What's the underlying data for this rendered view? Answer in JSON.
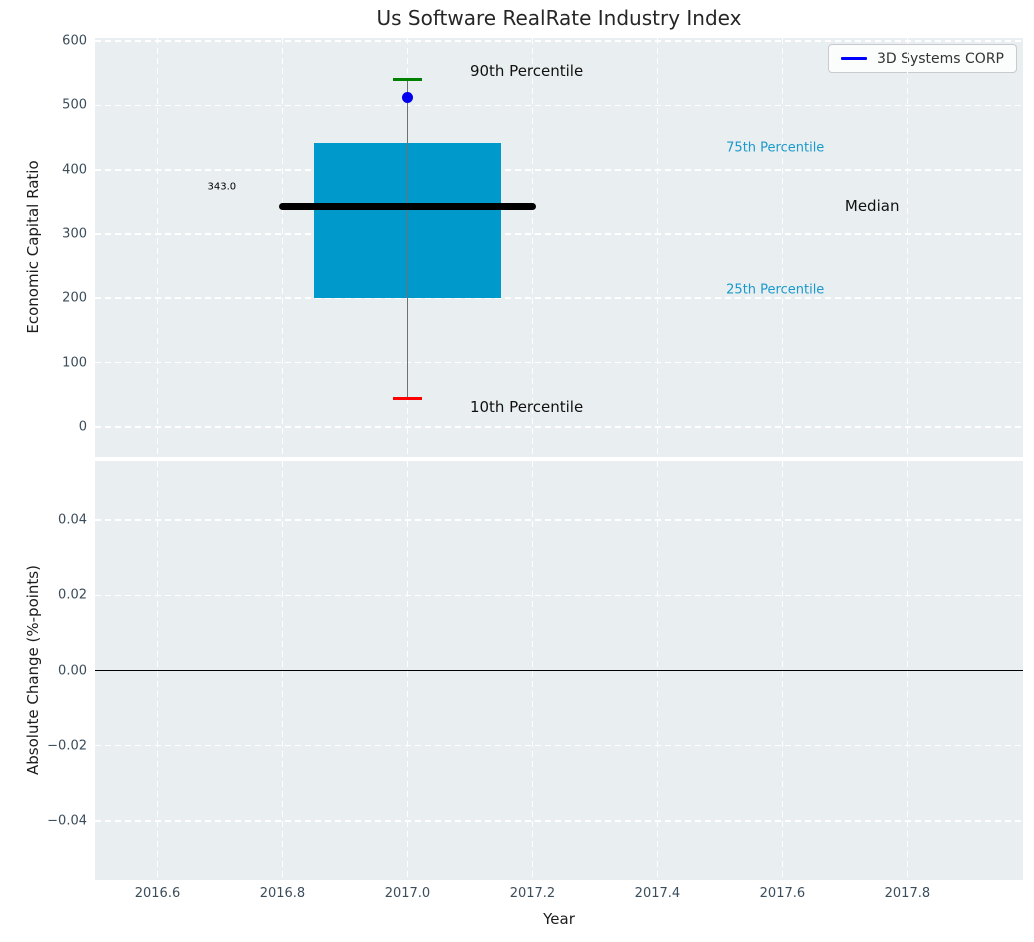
{
  "title": "Us Software RealRate Industry Index",
  "colors": {
    "axes_background": "#e9eef0",
    "grid": "#ffffff",
    "tick_label": "#3b4c5a",
    "box_fill": "#0099cc",
    "median_line": "#000000",
    "whisker": "#707070",
    "cap_90th": "#008000",
    "cap_10th": "#ff0000",
    "company_point": "#0000ee",
    "legend_line": "#0000ff",
    "zero_line": "#000000",
    "percentile_text_cyan": "#1a99cc"
  },
  "chart_data": [
    {
      "type": "boxplot",
      "panel": "top",
      "ylabel": "Economic Capital Ratio",
      "ylim": [
        -47,
        605
      ],
      "yticks": [
        0,
        100,
        200,
        300,
        400,
        500,
        600
      ],
      "ytick_labels": [
        "0",
        "100",
        "200",
        "300",
        "400",
        "500",
        "600"
      ],
      "xlim": [
        2016.5,
        2017.985
      ],
      "xgrid_ticks": [
        2016.6,
        2016.8,
        2017.0,
        2017.2,
        2017.4,
        2017.6,
        2017.8
      ],
      "grid": "white-dashed",
      "legend": {
        "label": "3D Systems CORP",
        "position": "upper right",
        "line_color": "#0000ff"
      },
      "box": {
        "x": 2017.0,
        "p10": 44,
        "p25": 200,
        "median": 343.0,
        "p75": 442,
        "p90": 540,
        "company_point": 513,
        "box_half_width": 0.15,
        "median_half_width": 0.205,
        "cap_half_width": 0.023
      },
      "annotations": [
        {
          "text": "343.0",
          "x": 2016.68,
          "y": 373,
          "color": "#000000",
          "size": 10,
          "name": "median-value-label"
        },
        {
          "text": "90th Percentile",
          "x": 2017.1,
          "y": 554,
          "color": "#111111",
          "size": 15,
          "name": "p90-label"
        },
        {
          "text": "75th Percentile",
          "x": 2017.51,
          "y": 434,
          "color": "#1a99cc",
          "size": 13,
          "name": "p75-label"
        },
        {
          "text": "Median",
          "x": 2017.7,
          "y": 344,
          "color": "#111111",
          "size": 15,
          "name": "median-label"
        },
        {
          "text": "25th Percentile",
          "x": 2017.51,
          "y": 213,
          "color": "#1a99cc",
          "size": 13,
          "name": "p25-label"
        },
        {
          "text": "10th Percentile",
          "x": 2017.1,
          "y": 31,
          "color": "#111111",
          "size": 15,
          "name": "p10-label"
        }
      ]
    },
    {
      "type": "line",
      "panel": "bottom",
      "xlabel": "Year",
      "ylabel": "Absolute Change (%-points)",
      "ylim": [
        -0.0558,
        0.0558
      ],
      "yticks": [
        0.04,
        0.02,
        0.0,
        -0.02,
        -0.04
      ],
      "ytick_labels": [
        "0.04",
        "0.02",
        "0.00",
        "−0.02",
        "−0.04"
      ],
      "xlim": [
        2016.5,
        2017.985
      ],
      "xticks": [
        2016.6,
        2016.8,
        2017.0,
        2017.2,
        2017.4,
        2017.6,
        2017.8
      ],
      "xtick_labels": [
        "2016.6",
        "2016.8",
        "2017.0",
        "2017.2",
        "2017.4",
        "2017.6",
        "2017.8"
      ],
      "grid": "white-dashed",
      "zero_line": {
        "y": 0.0,
        "color": "#000000"
      }
    }
  ]
}
